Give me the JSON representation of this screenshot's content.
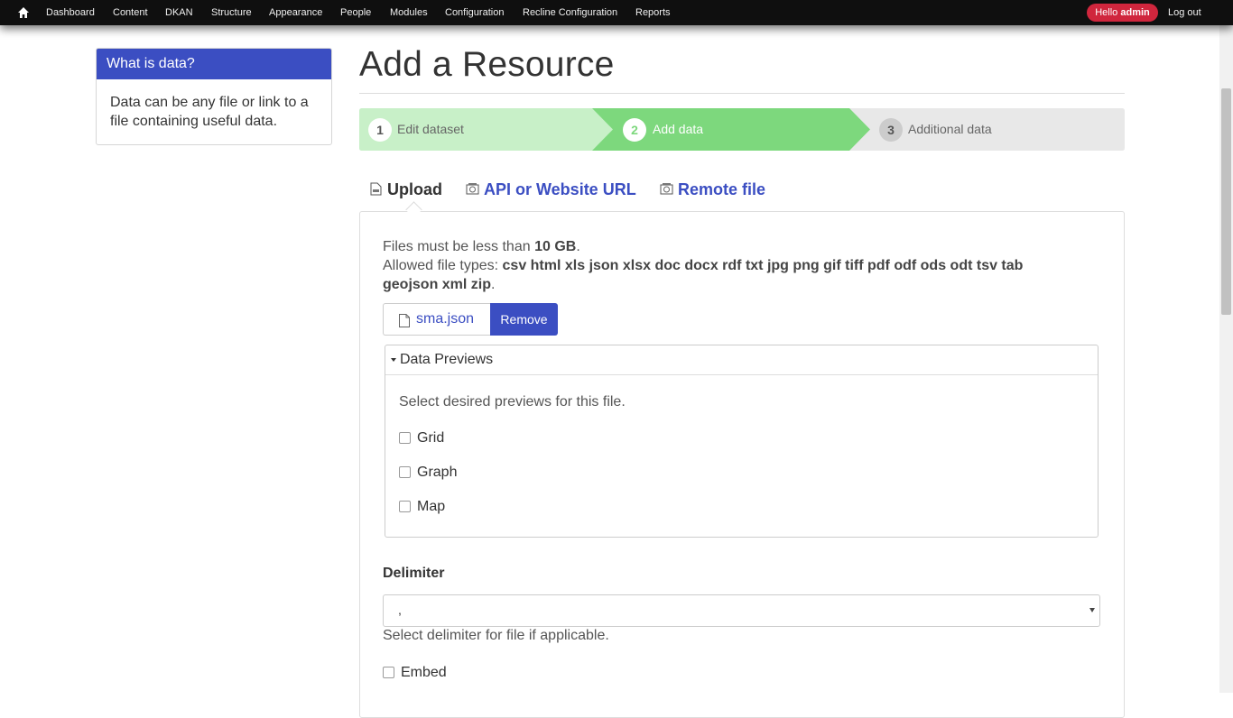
{
  "toolbar": {
    "home_icon": "home-icon",
    "items": [
      "Dashboard",
      "Content",
      "DKAN",
      "Structure",
      "Appearance",
      "People",
      "Modules",
      "Configuration",
      "Recline Configuration",
      "Reports"
    ],
    "hello_prefix": "Hello",
    "hello_user": "admin",
    "logout": "Log out",
    "colors": {
      "bar": "#0f0f0f",
      "badge": "#d0263d"
    }
  },
  "sidebar": {
    "title": "What is data?",
    "body": "Data can be any file or link to a file containing useful data."
  },
  "main": {
    "title": "Add a Resource",
    "steps": [
      {
        "num": "1",
        "label": "Edit dataset",
        "state": "done"
      },
      {
        "num": "2",
        "label": "Add data",
        "state": "active"
      },
      {
        "num": "3",
        "label": "Additional data",
        "state": "pending"
      }
    ],
    "tabs": [
      {
        "label": "Upload",
        "icon": "upload-icon",
        "active": true
      },
      {
        "label": "API or Website URL",
        "icon": "api-icon",
        "active": false
      },
      {
        "label": "Remote file",
        "icon": "remote-file-icon",
        "active": false
      }
    ],
    "upload": {
      "size_prefix": "Files must be less than",
      "size_value": "10 GB",
      "types_prefix": "Allowed file types:",
      "types_line1": "csv html xls json xlsx doc docx rdf txt jpg png gif tiff pdf odf ods odt tsv tab",
      "types_line2": "geojson xml zip",
      "file_name": "sma.json",
      "remove_label": "Remove"
    },
    "previews": {
      "legend": "Data Previews",
      "description": "Select desired previews for this file.",
      "options": [
        "Grid",
        "Graph",
        "Map"
      ]
    },
    "delimiter": {
      "label": "Delimiter",
      "value": ",",
      "help": "Select delimiter for file if applicable."
    },
    "embed_label": "Embed"
  },
  "colors": {
    "accent": "#3b4ec2",
    "step_done": "#c8f0c8",
    "step_active": "#7dd87d",
    "step_pending": "#e8e8e8"
  }
}
